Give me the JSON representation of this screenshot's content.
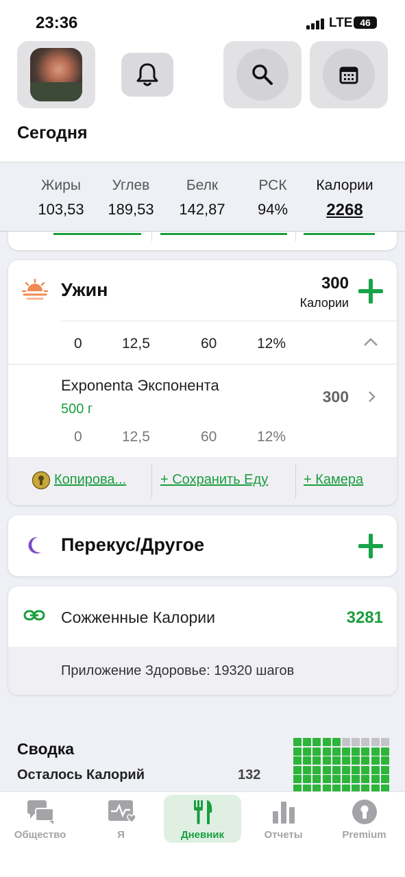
{
  "status_bar": {
    "time": "23:36",
    "network": "LTE",
    "battery": "46"
  },
  "header": {
    "title": "Сегодня"
  },
  "macros": [
    {
      "label": "Жиры",
      "value": "103,53"
    },
    {
      "label": "Углев",
      "value": "189,53"
    },
    {
      "label": "Белк",
      "value": "142,87"
    },
    {
      "label": "РСК",
      "value": "94%"
    },
    {
      "label": "Калории",
      "value": "2268"
    }
  ],
  "dinner": {
    "title": "Ужин",
    "calories": "300",
    "calories_label": "Калории",
    "totals": [
      "0",
      "12,5",
      "60",
      "12%"
    ],
    "food": {
      "name": "Exponenta Экспонента",
      "amount": "500 г",
      "calories": "300",
      "nutrients": [
        "0",
        "12,5",
        "60",
        "12%"
      ]
    },
    "actions": {
      "copy": "Копирова...",
      "save": "+ Сохранить Еду",
      "camera": "+ Камера"
    }
  },
  "snack": {
    "title": "Перекус/Другое"
  },
  "burned": {
    "title": "Сожженные Калории",
    "value": "3281",
    "source": "Приложение Здоровье: 19320 шагов"
  },
  "summary": {
    "title": "Сводка",
    "remaining_label": "Осталось Калорий",
    "remaining_value": "132"
  },
  "tabs": [
    {
      "label": "Общество",
      "icon": "chat-bubbles-icon"
    },
    {
      "label": "Я",
      "icon": "heart-pulse-icon"
    },
    {
      "label": "Дневник",
      "icon": "fork-knife-icon"
    },
    {
      "label": "Отчеты",
      "icon": "bar-chart-icon"
    },
    {
      "label": "Premium",
      "icon": "keyhole-icon"
    }
  ],
  "colors": {
    "accent": "#1a9d3e",
    "muted": "#a4a4a8",
    "sunset": "#f08a52",
    "moon": "#7b4fc4"
  }
}
